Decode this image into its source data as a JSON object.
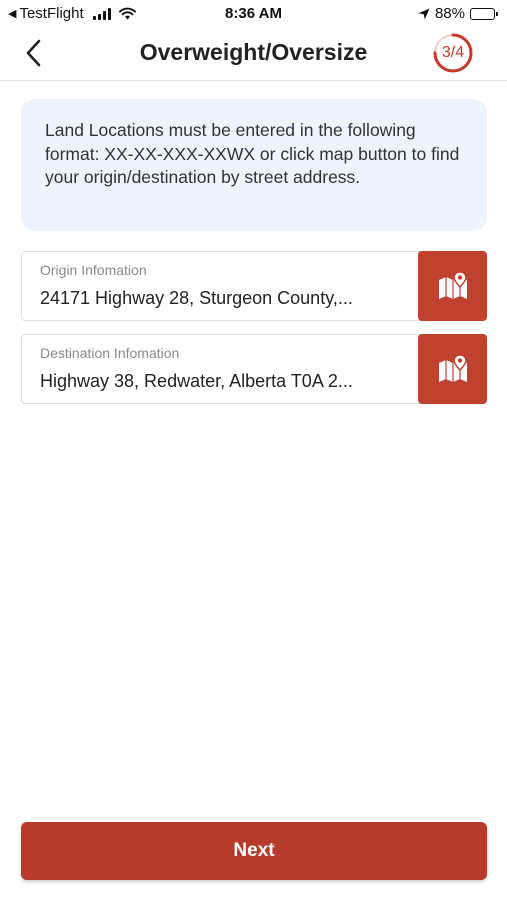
{
  "status_bar": {
    "carrier": "TestFlight",
    "time": "8:36 AM",
    "battery_percent": "88%",
    "battery_level": 0.88
  },
  "nav": {
    "title": "Overweight/Oversize",
    "step_indicator": "3/4",
    "step_progress": 0.75,
    "accent_color": "#c73a2a"
  },
  "info": {
    "text": "Land Locations must be entered in the following format: XX-XX-XXX-XXWX or click map button to find your origin/destination by street address."
  },
  "origin": {
    "label": "Origin Infomation",
    "value": "24171 Highway 28, Sturgeon County,..."
  },
  "destination": {
    "label": "Destination Infomation",
    "value": "Highway 38, Redwater, Alberta T0A 2..."
  },
  "actions": {
    "next_label": "Next",
    "button_color": "#b83a2b"
  },
  "icons": {
    "back": "chevron-left-icon",
    "map": "map-pin-icon",
    "location": "location-arrow-icon"
  }
}
